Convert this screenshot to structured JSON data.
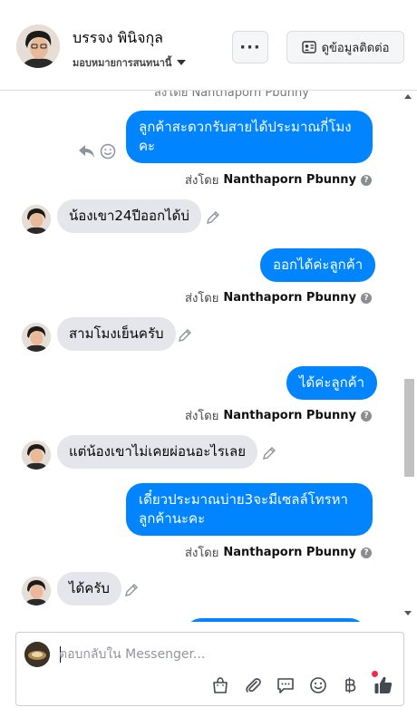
{
  "header": {
    "name": "บรรจง พินิจกุล",
    "assign_label": "มอบหมายการสนทนานี้",
    "more_label": "···",
    "contact_button_label": "ดูข้อมูลติดต่อ"
  },
  "thread": {
    "cut_top_text": "ส่งโดย Nanthaporn Pbunny",
    "messages": [
      {
        "side": "out",
        "lines": [
          "ลูกค้าสะดวกรับสายได้ประมาณกี่โมง",
          "คะ"
        ]
      },
      {
        "side": "in",
        "text": "น้องเขา24ปีออกได้บ่"
      },
      {
        "side": "out",
        "text": "ออกได้ค่ะลูกค้า"
      },
      {
        "side": "in",
        "text": "สามโมงเย็นครับ"
      },
      {
        "side": "out",
        "text": "ได้ค่ะลูกค้า"
      },
      {
        "side": "in",
        "text": "แต่น้องเขาไม่เคยผ่อนอะไรเลย"
      },
      {
        "side": "out",
        "lines": [
          "เดี๋ยวประมาณบ่าย3จะมีเซลล์โทรหา",
          "ลูกค้านะคะ"
        ]
      },
      {
        "side": "in",
        "text": "ได้ครับ"
      }
    ],
    "sent_by_prefix": "ส่งโดย",
    "sent_by_name": "Nanthaporn Pbunny",
    "info_glyph": "?"
  },
  "composer": {
    "placeholder": "ตอบกลับใน Messenger...",
    "value": ""
  },
  "icons": {
    "reply": "reply-icon",
    "emoji": "emoji-icon",
    "pencil": "pencil-icon",
    "shopping": "shopping-bag-icon",
    "attach": "paperclip-icon",
    "saved_reply": "saved-reply-icon",
    "emoji_tool": "emoji-icon",
    "payment": "baht-icon",
    "like": "thumbs-up-icon"
  },
  "colors": {
    "outgoing_bubble": "#0084ff",
    "incoming_bubble": "#e4e6eb",
    "like_icon": "#444950",
    "badge": "#f02849"
  }
}
